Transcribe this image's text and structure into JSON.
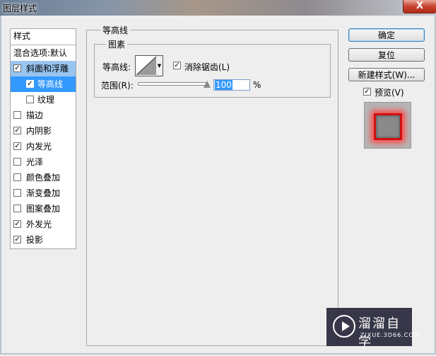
{
  "window": {
    "title": "图层样式",
    "close": "X"
  },
  "styles_panel": {
    "header": "样式",
    "blending": "混合选项:默认",
    "items": [
      {
        "label": "斜面和浮雕",
        "checked": true,
        "selected": true,
        "sub": false
      },
      {
        "label": "等高线",
        "checked": true,
        "selected": true,
        "sub": true
      },
      {
        "label": "纹理",
        "checked": false,
        "selected": false,
        "sub": true
      },
      {
        "label": "描边",
        "checked": false,
        "selected": false,
        "sub": false
      },
      {
        "label": "内阴影",
        "checked": true,
        "selected": false,
        "sub": false
      },
      {
        "label": "内发光",
        "checked": true,
        "selected": false,
        "sub": false
      },
      {
        "label": "光泽",
        "checked": false,
        "selected": false,
        "sub": false
      },
      {
        "label": "颜色叠加",
        "checked": false,
        "selected": false,
        "sub": false
      },
      {
        "label": "渐变叠加",
        "checked": false,
        "selected": false,
        "sub": false
      },
      {
        "label": "图案叠加",
        "checked": false,
        "selected": false,
        "sub": false
      },
      {
        "label": "外发光",
        "checked": true,
        "selected": false,
        "sub": false
      },
      {
        "label": "投影",
        "checked": true,
        "selected": false,
        "sub": false
      }
    ]
  },
  "contour_section": {
    "group_title": "等高线",
    "subgroup_title": "图素",
    "contour_label": "等高线:",
    "antialias_label": "消除锯齿(L)",
    "antialias_checked": true,
    "range_label": "范围(R):",
    "range_value": "100",
    "range_unit": "%",
    "range_fraction": 1.0
  },
  "buttons": {
    "ok": "确定",
    "reset": "复位",
    "new_style": "新建样式(W)...",
    "preview_label": "预览(V)",
    "preview_checked": true
  },
  "watermark": {
    "name": "溜溜自学",
    "url": "ZIXUE.3D66.COM"
  },
  "colors": {
    "selected_row": "#99c4f0",
    "selected_sub_row": "#3399ff",
    "glow": "#ff4b4b"
  }
}
